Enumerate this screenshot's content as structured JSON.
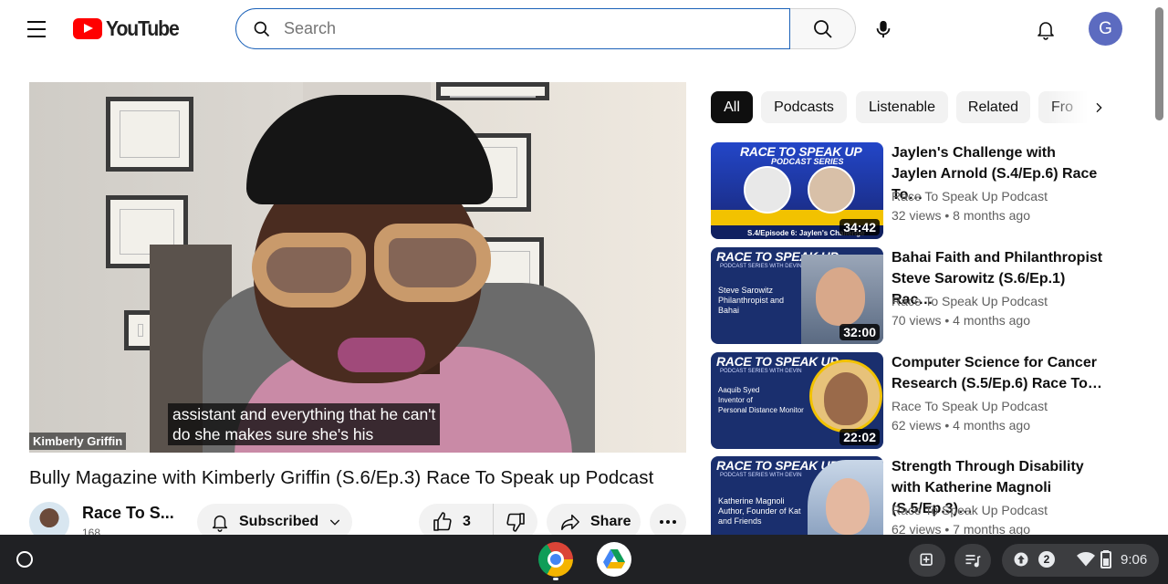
{
  "header": {
    "logo_text": "YouTube",
    "search_placeholder": "Search",
    "avatar_letter": "G"
  },
  "player": {
    "caption_line1": "assistant and everything that he can't",
    "caption_line2": "do she makes sure she's his",
    "nameplate": "Kimberly Griffin"
  },
  "video": {
    "title": "Bully Magazine with Kimberly Griffin (S.6/Ep.3) Race To Speak up Podcast",
    "channel_name": "Race To S...",
    "channel_subs": "168",
    "subscribe_label": "Subscribed",
    "like_count": "3",
    "share_label": "Share"
  },
  "chips": [
    {
      "label": "All",
      "active": true
    },
    {
      "label": "Podcasts",
      "active": false
    },
    {
      "label": "Listenable",
      "active": false
    },
    {
      "label": "Related",
      "active": false
    },
    {
      "label": "Fro",
      "active": false
    }
  ],
  "related": [
    {
      "title": "Jaylen's Challenge with Jaylen Arnold (S.4/Ep.6) Race To…",
      "channel": "Race To Speak Up Podcast",
      "views": "32 views",
      "age": "8 months ago",
      "duration": "34:42",
      "thumb_title": "RACE TO SPEAK UP",
      "thumb_sub": "PODCAST SERIES",
      "thumb_guest": "S.4/Episode 6: Jaylen's Challenge"
    },
    {
      "title": "Bahai Faith and Philanthropist Steve Sarowitz (S.6/Ep.1) Rac…",
      "channel": "Race To Speak Up Podcast",
      "views": "70 views",
      "age": "4 months ago",
      "duration": "32:00",
      "thumb_title": "RACE TO SPEAK UP",
      "thumb_sub": "PODCAST SERIES WITH DEVIN",
      "thumb_guest": "Steve Sarowitz\nPhilanthropist and\nBahai"
    },
    {
      "title": "Computer Science for Cancer Research (S.5/Ep.6) Race To…",
      "channel": "Race To Speak Up Podcast",
      "views": "62 views",
      "age": "4 months ago",
      "duration": "22:02",
      "thumb_title": "RACE TO SPEAK UP",
      "thumb_sub": "PODCAST SERIES WITH DEVIN",
      "thumb_guest": "Aaquib Syed\nInventor of\nPersonal Distance Monitor"
    },
    {
      "title": "Strength Through Disability with Katherine Magnoli (S.5/Ep.3)…",
      "channel": "Race To Speak Up Podcast",
      "views": "62 views",
      "age": "7 months ago",
      "duration": "",
      "thumb_title": "RACE TO SPEAK UP",
      "thumb_sub": "PODCAST SERIES WITH DEVIN",
      "thumb_guest": "Katherine Magnoli\nAuthor, Founder of Kat\nand Friends"
    }
  ],
  "shelf": {
    "notification_count": "2",
    "time": "9:06"
  }
}
